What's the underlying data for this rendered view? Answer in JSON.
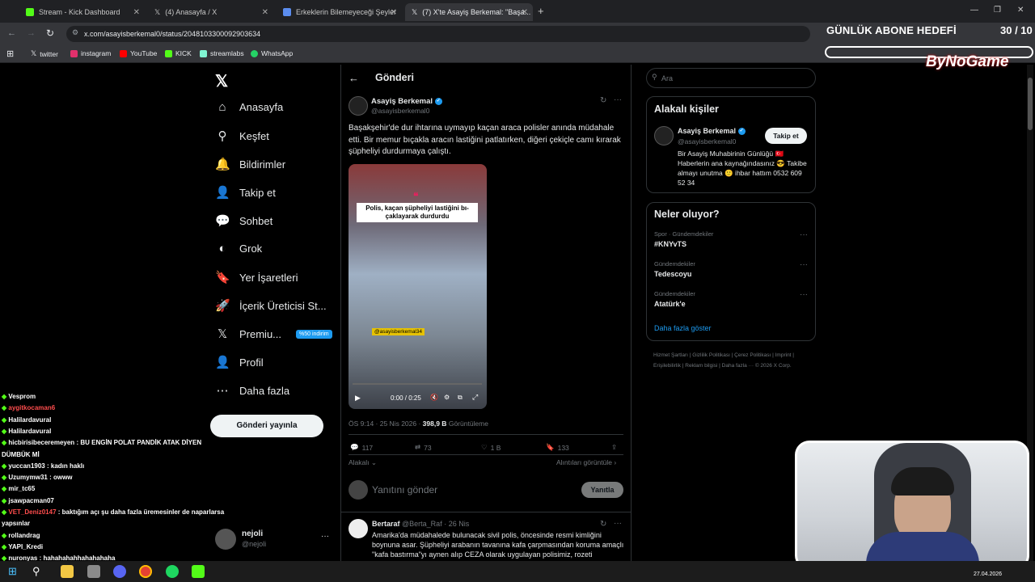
{
  "browser": {
    "tabs": [
      {
        "title": "Stream - Kick Dashboard",
        "color": "#53fc18"
      },
      {
        "title": "(4) Anasayfa / X",
        "color": "#ffffff"
      },
      {
        "title": "Erkeklerin Bilemeyeceği Şeyler",
        "color": "#5b8def"
      },
      {
        "title": "(7) X'te Asayiş Berkemal: \"Başa...",
        "color": "#ffffff"
      }
    ],
    "url": "x.com/asayisberkemal0/status/2048103300092903634",
    "bookmarks": [
      {
        "label": "twitter",
        "color": "#ffffff"
      },
      {
        "label": "instagram",
        "color": "#e1306c"
      },
      {
        "label": "YouTube",
        "color": "#ff0000"
      },
      {
        "label": "KICK",
        "color": "#53fc18"
      },
      {
        "label": "streamlabs",
        "color": "#80f5d2"
      },
      {
        "label": "WhatsApp",
        "color": "#25d366"
      }
    ]
  },
  "overlay": {
    "goal_title": "GÜNLÜK ABONE HEDEFİ",
    "goal_count": "30 / 10",
    "brand": "ByNoGame"
  },
  "nav": {
    "items": [
      {
        "label": "Anasayfa",
        "icon": "⌂"
      },
      {
        "label": "Keşfet",
        "icon": "⚲"
      },
      {
        "label": "Bildirimler",
        "icon": "🔔"
      },
      {
        "label": "Takip et",
        "icon": "👤"
      },
      {
        "label": "Sohbet",
        "icon": "💬"
      },
      {
        "label": "Grok",
        "icon": "◐"
      },
      {
        "label": "Yer İşaretleri",
        "icon": "🔖"
      },
      {
        "label": "İçerik Üreticisi St...",
        "icon": "🚀"
      },
      {
        "label": "Premiu...",
        "icon": "𝕏"
      },
      {
        "label": "Profil",
        "icon": "👤"
      },
      {
        "label": "Daha fazla",
        "icon": "⋯"
      }
    ],
    "premium_badge": "%50 indirim",
    "post_button": "Gönderi yayınla",
    "profile_name": "nejoli",
    "profile_handle": "@nejoli"
  },
  "post": {
    "header": "Gönderi",
    "author": "Asayiş Berkemal",
    "handle": "@asayisberkemal0",
    "text": "Başakşehir'de dur ihtarına uymayıp kaçan araca polisler anında müdahale etti. Bir memur bıçakla aracın lastiğini patlatırken, diğeri çekiçle camı kırarak şüpheliyi durdurmaya çalıştı.",
    "video_caption": "Polis, kaçan şüpheliyi lastiğini bı-çaklayarak durdurdu",
    "video_tag": "@asayisberkemal34",
    "video_time": "0:00 / 0:25",
    "time": "ÖS 9:14 · 25 Nis 2026 ·",
    "views": "398,9 B",
    "views_label": "Görüntüleme",
    "replies": "117",
    "reposts": "73",
    "likes": "1 B",
    "bookmarks": "133",
    "relevant": "Alakalı",
    "quotes": "Alıntıları görüntüle ›",
    "reply_placeholder": "Yanıtını gönder",
    "reply_button": "Yanıtla"
  },
  "reply": {
    "author": "Bertaraf",
    "handle": "@Berta_Raf · 26 Nis",
    "text": "Amarika'da müdahalede bulunacak sivil polis, öncesinde resmi kimliğini boynuna asar. Şüpheliyi arabanın tavanına kafa çarpmasından koruma amaçlı \"kafa bastırma\"yı aynen alıp CEZA olarak uygulayan polisimiz, rozeti"
  },
  "sidebar": {
    "search_placeholder": "Ara",
    "related_title": "Alakalı kişiler",
    "person_name": "Asayiş Berkemal",
    "person_handle": "@asayisberkemal0",
    "follow_button": "Takip et",
    "person_bio": "Bir Asayiş Muhabirinin Günlüğü 🇹🇷 Haberlerin ana kaynağındasınız 😎 Takibe almayı unutma 🙂 ihbar hattım 0532 609 52 34",
    "trends_title": "Neler oluyor?",
    "trends": [
      {
        "category": "Spor · Gündemdekiler",
        "name": "#KNYvTS"
      },
      {
        "category": "Gündemdekiler",
        "name": "Tedescoyu"
      },
      {
        "category": "Gündemdekiler",
        "name": "Atatürk'e"
      }
    ],
    "show_more": "Daha fazla göster",
    "footer": "Hizmet Şartları | Gizlilik Politikası | Çerez Politikası | Imprint | Erişilebilirlik | Reklam bilgisi | Daha fazla ··· © 2026 X Corp."
  },
  "chat": [
    {
      "user": "Vesprom",
      "msg": "",
      "color": "#ffffff"
    },
    {
      "user": "aygitkocaman6",
      "msg": "",
      "color": "#ff4d4d"
    },
    {
      "user": "Halilardavural",
      "msg": "",
      "color": "#ffffff"
    },
    {
      "user": "Halilardavural",
      "msg": "",
      "color": "#ffffff"
    },
    {
      "user": "hicbirisibeceremeyen",
      "msg": ": BU ENGİN POLAT PANDİK ATAK DİYEN",
      "color": "#ffffff"
    },
    {
      "user": "",
      "msg": "DÜMBÜK Mİ",
      "color": "#ffffff"
    },
    {
      "user": "yuccan1903",
      "msg": ": kadın haklı",
      "color": "#ffffff"
    },
    {
      "user": "Uzumymw31",
      "msg": ": owww",
      "color": "#ffffff"
    },
    {
      "user": "mir_tc65",
      "msg": "",
      "color": "#ffffff"
    },
    {
      "user": "jsawpacman07",
      "msg": "",
      "color": "#ffffff"
    },
    {
      "user": "VET_Deniz0147",
      "msg": ": baktığım açı şu daha fazla üremesinler de naparlarsa",
      "color": "#ff4d4d"
    },
    {
      "user": "",
      "msg": "yapsınlar",
      "color": "#ffffff"
    },
    {
      "user": "rollandrag",
      "msg": "",
      "color": "#ffffff"
    },
    {
      "user": "YAPI_Kredi",
      "msg": "",
      "color": "#ffffff"
    },
    {
      "user": "nuronyas",
      "msg": ": hahahahahhahahahaha",
      "color": "#ffffff"
    }
  ],
  "taskbar": {
    "time": "",
    "date": "27.04.2026"
  }
}
